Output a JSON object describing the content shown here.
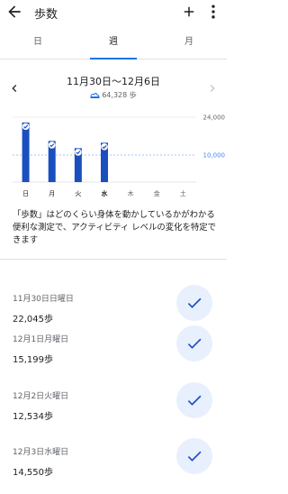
{
  "header": {
    "title": "歩数"
  },
  "tabs": [
    {
      "label": "日"
    },
    {
      "label": "週"
    },
    {
      "label": "月"
    }
  ],
  "range": {
    "label": "11月30日～12月6日",
    "total": "64,328 歩"
  },
  "chart_data": {
    "type": "bar",
    "categories": [
      "日",
      "月",
      "火",
      "水",
      "木",
      "金",
      "土"
    ],
    "values": [
      22045,
      15199,
      12534,
      14550,
      null,
      null,
      null
    ],
    "goal_reached": [
      true,
      true,
      true,
      true,
      false,
      false,
      false
    ],
    "ylim": [
      0,
      24000
    ],
    "ytick_labels": [
      "24,000",
      "10,000"
    ],
    "ytick_values": [
      24000,
      10000
    ],
    "goal": 10000,
    "highlight_category": "水",
    "colors": {
      "bar": "#1a4fbf",
      "goal": "#4285f4",
      "grid": "#dadce0"
    }
  },
  "description": "「歩数」はどのくらい身体を動かしているかがわかる便利な測定で、アクティビティ レベルの変化を特定できます",
  "days": [
    {
      "date": "11月30日日曜日",
      "steps": "22,045歩"
    },
    {
      "date": "12月1日月曜日",
      "steps": "15,199歩"
    },
    {
      "date": "12月2日火曜日",
      "steps": "12,534歩"
    },
    {
      "date": "12月3日水曜日",
      "steps": "14,550歩"
    }
  ],
  "icons": {
    "back": "arrow-back-icon",
    "add": "plus-icon",
    "more": "more-vert-icon",
    "prev": "chevron-left-icon",
    "next": "chevron-right-icon",
    "shoe": "shoe-icon",
    "check": "check-icon"
  }
}
